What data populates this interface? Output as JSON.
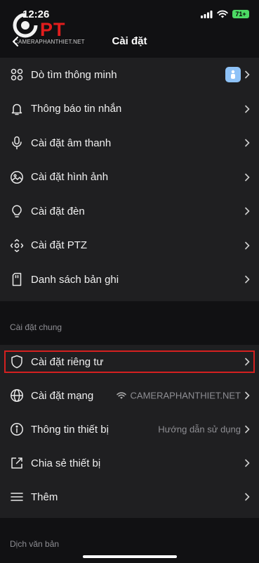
{
  "status": {
    "time": "12:26",
    "battery": "71+"
  },
  "logo": {
    "text": "PT",
    "subtitle": "CAMERAPHANTHIET.NET"
  },
  "header": {
    "title": "Cài đặt"
  },
  "main_items": [
    {
      "label": "Dò tìm thông minh",
      "icon": "smart-grid-icon"
    },
    {
      "label": "Thông báo tin nhắn",
      "icon": "bell-icon"
    },
    {
      "label": "Cài đặt âm thanh",
      "icon": "microphone-icon"
    },
    {
      "label": "Cài đặt hình ảnh",
      "icon": "image-icon"
    },
    {
      "label": "Cài đặt đèn",
      "icon": "lightbulb-icon"
    },
    {
      "label": "Cài đặt PTZ",
      "icon": "ptz-icon"
    },
    {
      "label": "Danh sách bản ghi",
      "icon": "sd-card-icon"
    }
  ],
  "general": {
    "header": "Cài đặt chung",
    "items": [
      {
        "label": "Cài đặt riêng tư",
        "icon": "shield-icon",
        "value": ""
      },
      {
        "label": "Cài đặt mạng",
        "icon": "globe-icon",
        "value": "CAMERAPHANTHIET.NET"
      },
      {
        "label": "Thông tin thiết bị",
        "icon": "info-icon",
        "value": "Hướng dẫn sử dụng"
      },
      {
        "label": "Chia sẻ thiết bị",
        "icon": "share-icon",
        "value": ""
      },
      {
        "label": "Thêm",
        "icon": "menu-icon",
        "value": ""
      }
    ]
  },
  "translation": {
    "header": "Dịch văn bản"
  },
  "colors": {
    "background": "#111113",
    "row_background": "#1f1f21",
    "highlight": "#d42020",
    "logo": "#e11d1d",
    "badge": "#8ec2f7"
  }
}
